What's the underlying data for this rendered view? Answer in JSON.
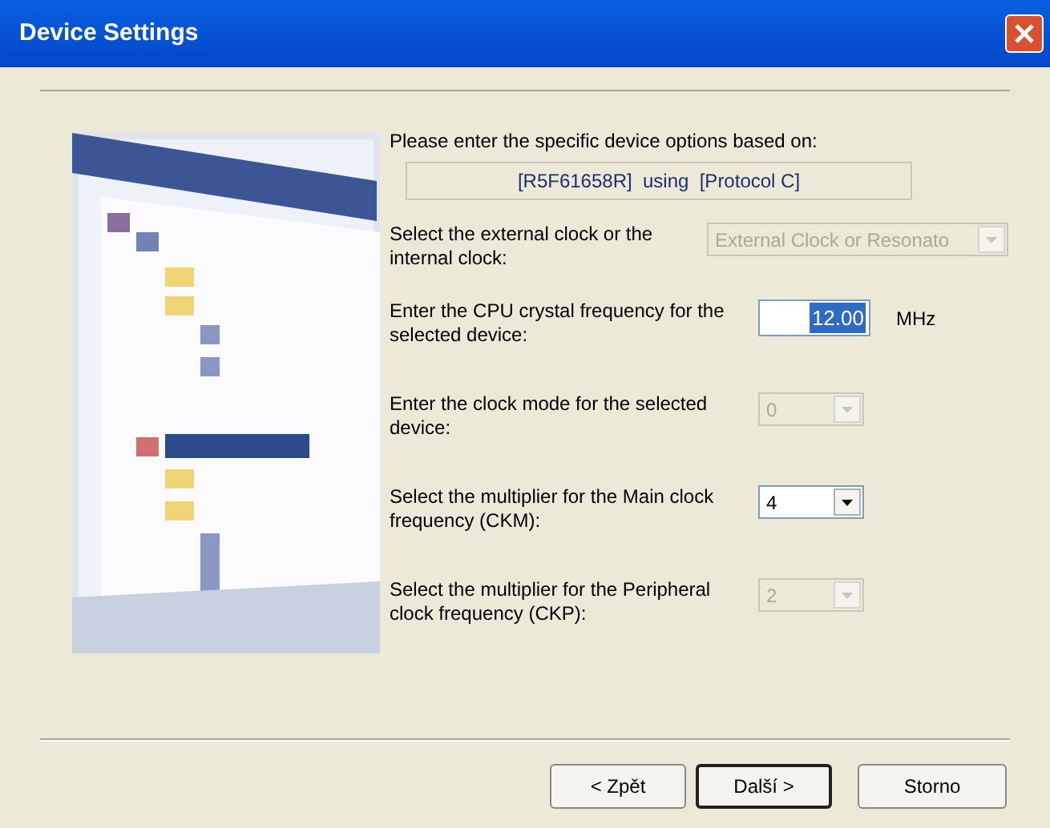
{
  "window": {
    "title": "Device Settings"
  },
  "intro": "Please enter the specific device options based on:",
  "device_summary": "[R5F61658R]  using  [Protocol C]",
  "fields": [
    {
      "kind": "combo",
      "label": "Select the external clock or the internal clock:",
      "value": "External Clock or Resonato",
      "disabled": true
    },
    {
      "kind": "text",
      "label": "Enter the CPU crystal frequency for the selected device:",
      "value": "12.00",
      "unit": "MHz",
      "disabled": false
    },
    {
      "kind": "combo",
      "label": "Enter the clock mode for the selected device:",
      "value": "0",
      "disabled": true
    },
    {
      "kind": "combo",
      "label": "Select the multiplier for the Main clock frequency (CKM):",
      "value": "4",
      "disabled": false
    },
    {
      "kind": "combo",
      "label": "Select the multiplier for the Peripheral clock frequency (CKP):",
      "value": "2",
      "disabled": true
    }
  ],
  "buttons": [
    {
      "label": "< Zpět",
      "default": false
    },
    {
      "label": "Další >",
      "default": true
    },
    {
      "label": "Storno",
      "default": false
    }
  ]
}
